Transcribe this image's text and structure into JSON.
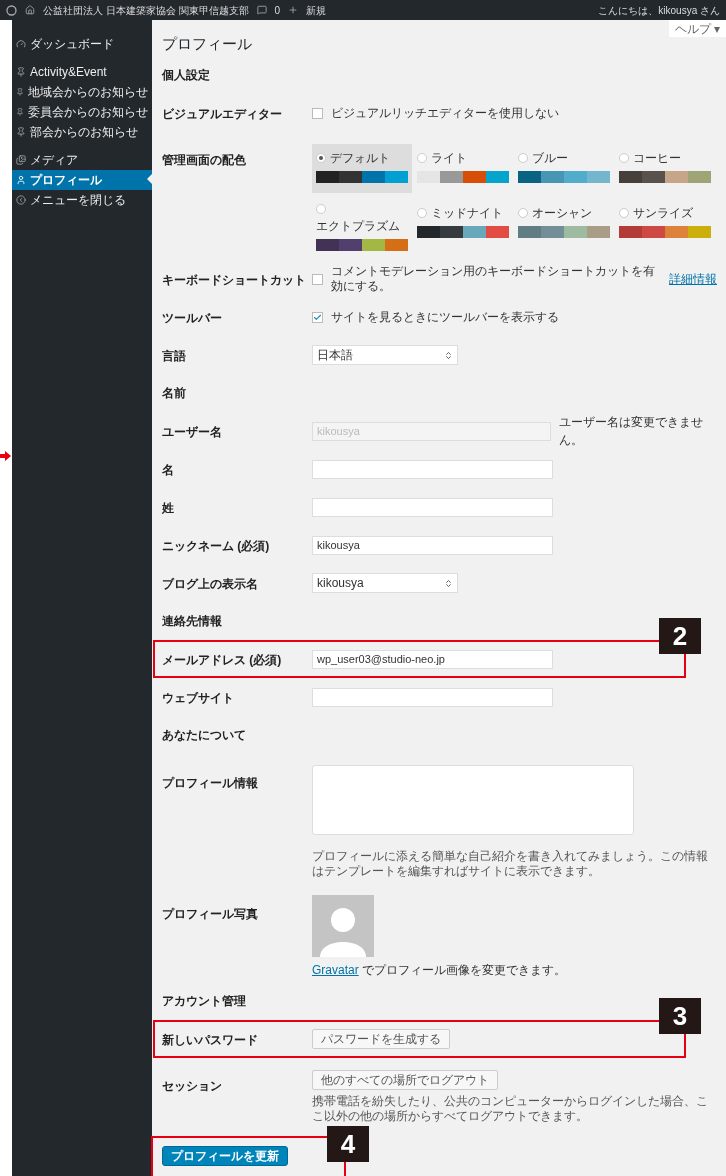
{
  "admin_bar": {
    "site_name": "公益社団法人 日本建築家協会 関東甲信越支部",
    "comments": "0",
    "new": "新規",
    "greeting": "こんにちは、kikousya さん"
  },
  "sidebar": {
    "items": [
      {
        "label": "ダッシュボード",
        "selected": false
      },
      {
        "label": "Activity&Event",
        "selected": false
      },
      {
        "label": "地域会からのお知らせ",
        "selected": false
      },
      {
        "label": "委員会からのお知らせ",
        "selected": false
      },
      {
        "label": "部会からのお知らせ",
        "selected": false
      },
      {
        "label": "メディア",
        "selected": false
      },
      {
        "label": "プロフィール",
        "selected": true
      },
      {
        "label": "メニューを閉じる",
        "selected": false
      }
    ]
  },
  "help": "ヘルプ ▾",
  "title": "プロフィール",
  "rows": [
    {
      "kind": "heading",
      "label": "個人設定"
    },
    {
      "kind": "checkbox",
      "label": "ビジュアルエディター",
      "text": "ビジュアルリッチエディターを使用しない",
      "checked": false
    },
    {
      "kind": "schemes",
      "label": "管理画面の配色",
      "schemes": [
        {
          "name": "デフォルト",
          "selected": true
        },
        {
          "name": "ライト",
          "selected": false
        },
        {
          "name": "ブルー",
          "selected": false
        },
        {
          "name": "コーヒー",
          "selected": false
        },
        {
          "name": "エクトプラズム",
          "selected": false
        },
        {
          "name": "ミッドナイト",
          "selected": false
        },
        {
          "name": "オーシャン",
          "selected": false
        },
        {
          "name": "サンライズ",
          "selected": false
        }
      ]
    },
    {
      "kind": "checkbox",
      "label": "キーボードショートカット",
      "text": "コメントモデレーション用のキーボードショートカットを有効にする。",
      "link": "詳細情報",
      "checked": false
    },
    {
      "kind": "checkbox",
      "label": "ツールバー",
      "text": "サイトを見るときにツールバーを表示する",
      "checked": true
    },
    {
      "kind": "select",
      "label": "言語",
      "value": "日本語"
    },
    {
      "kind": "heading",
      "label": "名前"
    },
    {
      "kind": "text",
      "label": "ユーザー名",
      "value": "kikousya",
      "disabled": true,
      "note": "ユーザー名は変更できません。"
    },
    {
      "kind": "text",
      "label": "名"
    },
    {
      "kind": "text",
      "label": "姓"
    },
    {
      "kind": "text",
      "label": "ニックネーム (必須)",
      "value": "kikousya"
    },
    {
      "kind": "select",
      "label": "ブログ上の表示名",
      "value": "kikousya"
    },
    {
      "kind": "heading",
      "label": "連絡先情報"
    },
    {
      "kind": "text",
      "label": "メールアドレス (必須)",
      "value": "wp_user03@studio-neo.jp",
      "annotation": "2"
    },
    {
      "kind": "text",
      "label": "ウェブサイト"
    },
    {
      "kind": "heading",
      "label": "あなたについて"
    },
    {
      "kind": "textarea",
      "label": "プロフィール情報",
      "note": "プロフィールに添える簡単な自己紹介を書き入れてみましょう。この情報はテンプレートを編集すればサイトに表示できます。"
    },
    {
      "kind": "avatar",
      "label": "プロフィール写真",
      "link": "Gravatar",
      "note": "でプロフィール画像を変更できます。"
    },
    {
      "kind": "heading",
      "label": "アカウント管理"
    },
    {
      "kind": "button",
      "label": "新しいパスワード",
      "button": "パスワードを生成する",
      "annotation": "3"
    },
    {
      "kind": "button",
      "label": "セッション",
      "button": "他のすべての場所でログアウト",
      "note": "携帯電話を紛失したり、公共のコンピューターからログインした場合、ここ以外の他の場所からすべてログアウトできます。"
    }
  ],
  "submit": {
    "label": "プロフィールを更新",
    "annotation": "4"
  }
}
